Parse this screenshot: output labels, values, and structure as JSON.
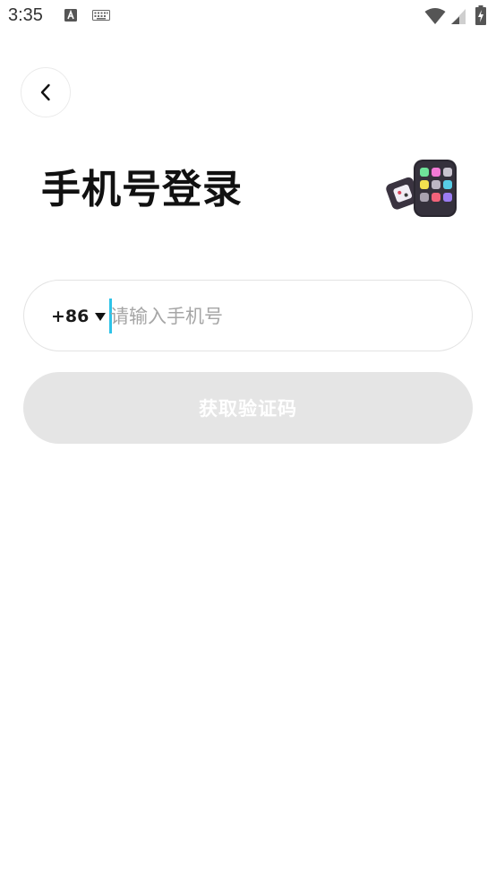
{
  "status_bar": {
    "time": "3:35",
    "icons": [
      "text-a-icon",
      "keyboard-icon",
      "wifi-icon",
      "signal-icon",
      "battery-charging-icon"
    ]
  },
  "header": {
    "back_icon": "chevron-left-icon",
    "title": "手机号登录",
    "illustration_icon": "phone-apps-illustration"
  },
  "login_form": {
    "country_code": "+86",
    "country_code_icon": "triangle-down-icon",
    "phone_value": "",
    "phone_placeholder": "请输入手机号",
    "get_code_label": "获取验证码"
  },
  "colors": {
    "cursor": "#2ec3e8",
    "button_disabled_bg": "#e5e5e5",
    "button_disabled_text": "#ffffff",
    "placeholder": "#a6a6a6",
    "border": "#e3e3e3"
  }
}
